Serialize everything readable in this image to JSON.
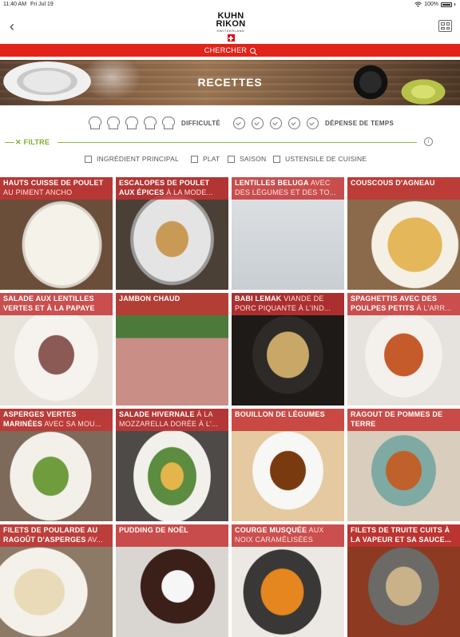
{
  "status_bar": {
    "time": "11:40 AM",
    "date": "Fri Jul 19",
    "battery": "100%"
  },
  "header": {
    "back_icon": "chevron-left-icon",
    "logo": {
      "line1": "KUHN",
      "line2": "RIKON",
      "line3": "SWITZERLAND"
    },
    "view_toggle_icon": "grid-view-icon"
  },
  "search": {
    "label": "CHERCHER",
    "icon": "search-icon"
  },
  "banner": {
    "title": "RECETTES"
  },
  "difficulty": {
    "label": "DIFFICULTÉ",
    "levels": 5
  },
  "time_effort": {
    "label": "DÉPENSE DE TEMPS",
    "levels": 5
  },
  "filter": {
    "label": "FILTRE",
    "icon": "close-icon",
    "info_icon": "info-icon"
  },
  "filters": [
    {
      "label": "INGRÉDIENT PRINCIPAL"
    },
    {
      "label": "PLAT"
    },
    {
      "label": "SAISON"
    },
    {
      "label": "USTENSILE DE CUISINE"
    }
  ],
  "colors": {
    "accent_red": "#e2231a",
    "filter_green": "#7aaf2b",
    "caption_red": "#c43434"
  },
  "recipes": [
    {
      "title": "HAUTS CUISSE DE POULET",
      "sub": "AU PIMENT ANCHO"
    },
    {
      "title": "ESCALOPES DE POULET AUX ÉPICES",
      "sub": "À LA MODE..."
    },
    {
      "title": "LENTILLES BELUGA",
      "sub": "AVEC DES LÉGUMES ET DES TO..."
    },
    {
      "title": "COUSCOUS D'AGNEAU",
      "sub": ""
    },
    {
      "title": "SALADE AUX LENTILLES VERTES ET À LA PAPAYE",
      "sub": ""
    },
    {
      "title": "JAMBON CHAUD",
      "sub": ""
    },
    {
      "title": "BABI LEMAK",
      "sub": "VIANDE DE PORC PIQUANTE À L'IND..."
    },
    {
      "title": "SPAGHETTIS AVEC DES POULPES PETITS",
      "sub": "À L'ARR..."
    },
    {
      "title": "ASPERGES VERTES MARINÉES",
      "sub": "AVEC SA MOU..."
    },
    {
      "title": "SALADE HIVERNALE",
      "sub": "À LA MOZZARELLA DORÉE À L'..."
    },
    {
      "title": "BOUILLON DE LÉGUMES",
      "sub": ""
    },
    {
      "title": "RAGOUT DE POMMES DE TERRE",
      "sub": ""
    },
    {
      "title": "FILETS DE POULARDE AU RAGOÛT D'ASPERGES",
      "sub": "AV..."
    },
    {
      "title": "PUDDING DE NOËL",
      "sub": ""
    },
    {
      "title": "COURGE MUSQUÉE",
      "sub": "AUX NOIX CARAMÉLISÉES"
    },
    {
      "title": "FILETS DE TRUITE CUITS À LA VAPEUR ET SA SAUCE...",
      "sub": ""
    }
  ]
}
